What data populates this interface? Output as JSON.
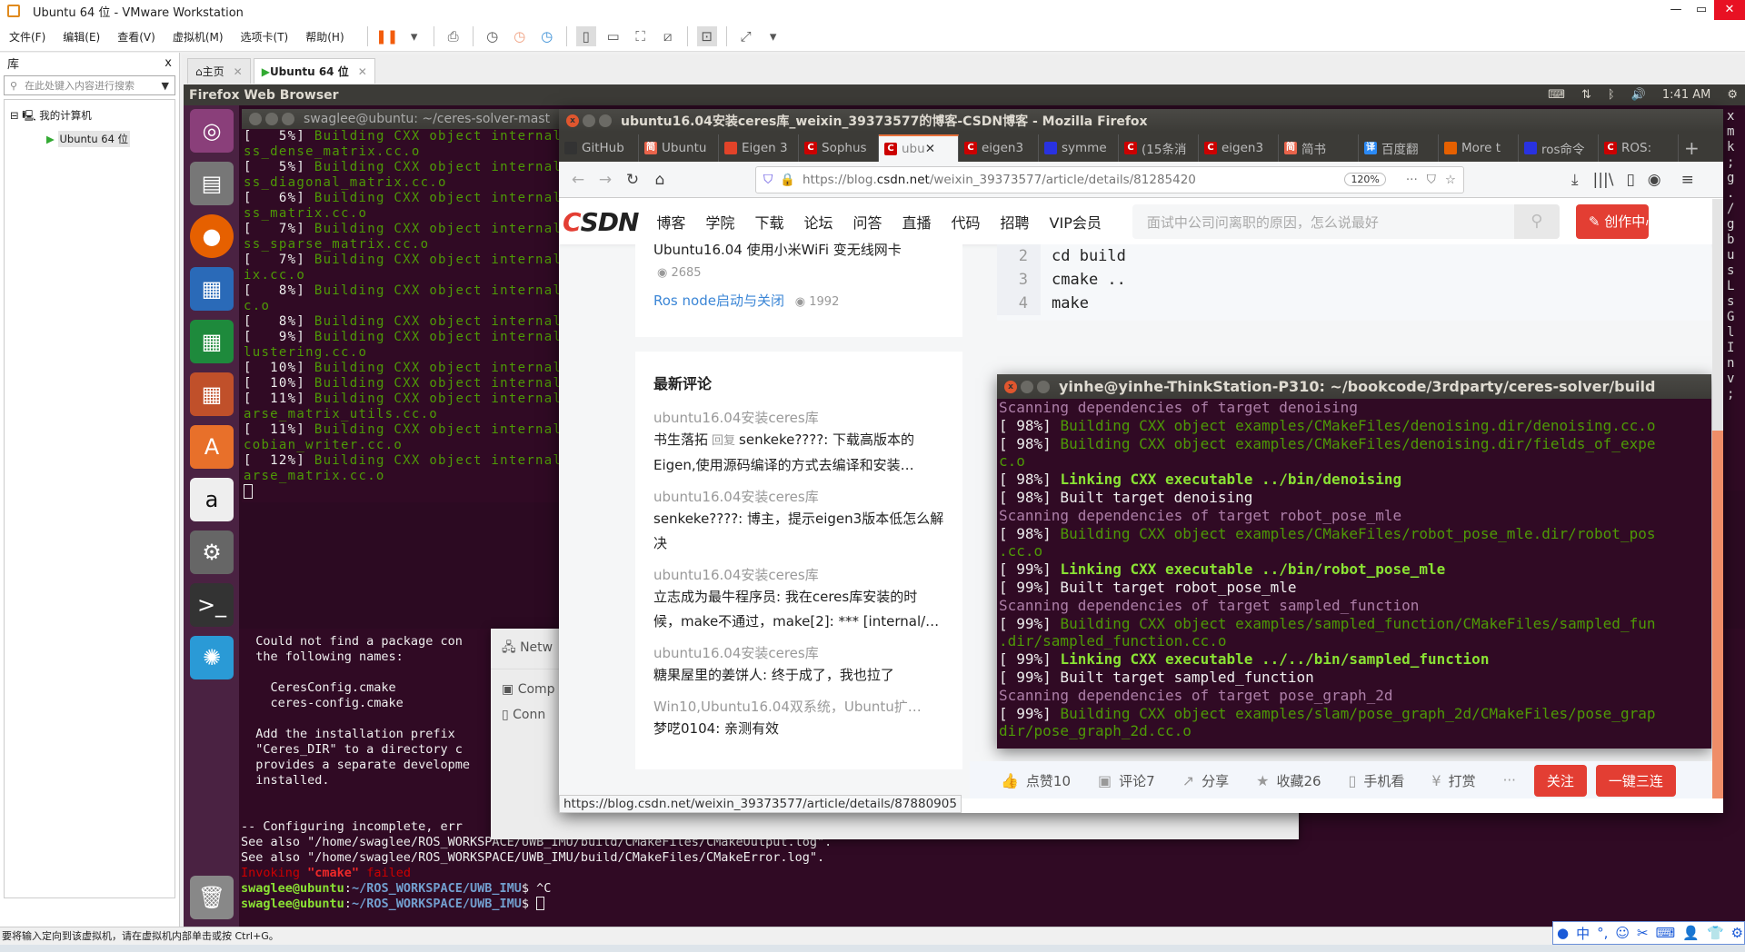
{
  "vmware": {
    "title": "Ubuntu 64 位 - VMware Workstation",
    "menu": [
      "文件(F)",
      "编辑(E)",
      "查看(V)",
      "虚拟机(M)",
      "选项卡(T)",
      "帮助(H)"
    ],
    "library": {
      "title": "库",
      "close": "x",
      "search_placeholder": "在此处键入内容进行搜索",
      "tree_root": "我的计算机",
      "tree_vm": "Ubuntu 64 位"
    },
    "tabs": [
      {
        "label": "主页"
      },
      {
        "label": "Ubuntu 64 位"
      }
    ],
    "statusbar": "要将输入定向到该虚拟机，请在虚拟机内部单击或按 Ctrl+G。"
  },
  "ubuntu": {
    "panel_title": "Firefox Web Browser",
    "clock": "1:41 AM"
  },
  "left_terminal": {
    "title": "swaglee@ubuntu: ~/ceres-solver-mast",
    "lines": [
      [
        "[   5%] ",
        "Building CXX object internal/cer"
      ],
      [
        "",
        "ss_dense_matrix.cc.o"
      ],
      [
        "[   5%] ",
        "Building CXX object internal/cer"
      ],
      [
        "",
        "ss_diagonal_matrix.cc.o"
      ],
      [
        "[   6%] ",
        "Building CXX object internal/cer"
      ],
      [
        "",
        "ss_matrix.cc.o"
      ],
      [
        "[   7%] ",
        "Building CXX object internal/cer"
      ],
      [
        "",
        "ss_sparse_matrix.cc.o"
      ],
      [
        "[   7%] ",
        "Building CXX object internal/cer"
      ],
      [
        "",
        "ix.cc.o"
      ],
      [
        "[   8%] ",
        "Building CXX object internal/cer"
      ],
      [
        "",
        "c.o"
      ],
      [
        "[   8%] ",
        "Building CXX object internal/cer"
      ],
      [
        "[   9%] ",
        "Building CXX object internal/cer"
      ],
      [
        "",
        "lustering.cc.o"
      ],
      [
        "[  10%] ",
        "Building CXX object internal/cer"
      ],
      [
        "[  10%] ",
        "Building CXX object internal/cer"
      ],
      [
        "[  11%] ",
        "Building CXX object internal/cer"
      ],
      [
        "",
        "arse_matrix_utils.cc.o"
      ],
      [
        "[  11%] ",
        "Building CXX object internal/cer"
      ],
      [
        "",
        "cobian_writer.cc.o"
      ],
      [
        "[  12%] ",
        "Building CXX object internal/cer"
      ],
      [
        "",
        "arse_matrix.cc.o"
      ]
    ]
  },
  "bottom_terminal": {
    "lines": [
      "  Could not find a package con",
      "  the following names:",
      "",
      "    CeresConfig.cmake",
      "    ceres-config.cmake",
      "",
      "  Add the installation prefix",
      "  \"Ceres_DIR\" to a directory c",
      "  provides a separate developme",
      "  installed.",
      "",
      "",
      "-- Configuring incomplete, err",
      "See also \"/home/swaglee/ROS_WORKSPACE/UWB_IMU/build/CMakeFiles/CMakeOutput.log\".",
      "See also \"/home/swaglee/ROS_WORKSPACE/UWB_IMU/build/CMakeFiles/CMakeError.log\"."
    ],
    "invoking": "Invoking ",
    "cmake": "\"cmake\"",
    "failed": " failed",
    "prompt_user": "swaglee@ubuntu",
    "prompt_path": "~/ROS_WORKSPACE/UWB_IMU",
    "cmd1": " ^C",
    "cmd2": " "
  },
  "settings_panel": {
    "items": [
      "Netw",
      "Comp",
      "Conn"
    ]
  },
  "right_strip": [
    "x",
    "m",
    "k",
    ";",
    "g",
    ".",
    "/",
    "g",
    "b",
    "u",
    "s",
    "L",
    "s",
    "G",
    "l",
    "I",
    "n",
    "v",
    ";"
  ],
  "firefox": {
    "title": "ubuntu16.04安装ceres库_weixin_39373577的博客-CSDN博客 - Mozilla Firefox",
    "tabs": [
      {
        "label": "GitHub",
        "fav": "github",
        "color": "#333"
      },
      {
        "label": "Ubuntu",
        "fav": "简",
        "color": "#e9644b"
      },
      {
        "label": "Eigen 3",
        "fav": "gitlab",
        "color": "#e24329"
      },
      {
        "label": "Sophus",
        "fav": "C",
        "color": "#c00"
      },
      {
        "label": "ubu",
        "fav": "C",
        "color": "#c00",
        "active": true
      },
      {
        "label": "eigen3",
        "fav": "C",
        "color": "#c00"
      },
      {
        "label": "symme",
        "fav": "baidu",
        "color": "#2932e1"
      },
      {
        "label": "(15条消",
        "fav": "C",
        "color": "#c00"
      },
      {
        "label": "eigen3",
        "fav": "C",
        "color": "#c00"
      },
      {
        "label": "简书",
        "fav": "简",
        "color": "#e9644b"
      },
      {
        "label": "百度翻",
        "fav": "译",
        "color": "#2b8af6"
      },
      {
        "label": "More t",
        "fav": "firefox",
        "color": "#e66000"
      },
      {
        "label": "ros命令",
        "fav": "baidu",
        "color": "#2932e1"
      },
      {
        "label": "ROS:",
        "fav": "C",
        "color": "#c00"
      }
    ],
    "url_proto": "https://blog.",
    "url_host": "csdn.net",
    "url_path": "/weixin_39373577/article/details/81285420",
    "zoom": "120%",
    "status_url": "https://blog.csdn.net/weixin_39373577/article/details/87880905"
  },
  "csdn": {
    "nav": [
      "博客",
      "学院",
      "下载",
      "论坛",
      "问答",
      "直播",
      "代码",
      "招聘",
      "VIP会员"
    ],
    "search_placeholder": "面试中公司问离职的原因，怎么说最好",
    "create": "创作中心",
    "articles": [
      {
        "title": "Ubuntu16.04 使用小米WiFi 变无线网卡",
        "views": "2685"
      },
      {
        "title": "Ros node启动与关闭",
        "views": "1992"
      }
    ],
    "comments_title": "最新评论",
    "comments": [
      {
        "article": "ubuntu16.04安装ceres库",
        "user": "书生落拓",
        "reply": "回复",
        "body": "senkeke????: 下载高版本的Eigen,使用源码编译的方式去编译和安装…"
      },
      {
        "article": "ubuntu16.04安装ceres库",
        "user": "senkeke????",
        "body": ": 博主，提示eigen3版本低怎么解决"
      },
      {
        "article": "ubuntu16.04安装ceres库",
        "user": "立志成为最牛程序员",
        "body": ": 我在ceres库安装的时候，make不通过，make[2]: *** [internal/…"
      },
      {
        "article": "ubuntu16.04安装ceres库",
        "user": "糖果屋里的姜饼人",
        "body": ": 终于成了，我也拉了"
      },
      {
        "article": "Win10,Ubuntu16.04双系统，Ubuntu扩…",
        "user": "梦呓0104",
        "body": ": 亲测有效"
      }
    ],
    "code": [
      {
        "n": "2",
        "t": "cd build"
      },
      {
        "n": "3",
        "t": "cmake .."
      },
      {
        "n": "4",
        "t": "make"
      }
    ],
    "toolbar": {
      "like": "点赞10",
      "comment": "评论7",
      "share": "分享",
      "fav": "收藏26",
      "mobile": "手机看",
      "reward": "打赏",
      "more": "···",
      "follow": "关注",
      "onekey": "一键三连"
    },
    "read_progress": 0.64
  },
  "right_terminal": {
    "title": "yinhe@yinhe-ThinkStation-P310: ~/bookcode/3rdparty/ceres-solver/build",
    "lines": [
      [
        "p",
        "Scanning dependencies of target denoising"
      ],
      [
        "w|g",
        "[ 98%] |Building CXX object examples/CMakeFiles/denoising.dir/denoising.cc.o"
      ],
      [
        "w|g",
        "[ 98%] |Building CXX object examples/CMakeFiles/denoising.dir/fields_of_expe"
      ],
      [
        "g",
        "c.o"
      ],
      [
        "w|gb",
        "[ 98%] |Linking CXX executable ../bin/denoising"
      ],
      [
        "w",
        "[ 98%] Built target denoising"
      ],
      [
        "p",
        "Scanning dependencies of target robot_pose_mle"
      ],
      [
        "w|g",
        "[ 98%] |Building CXX object examples/CMakeFiles/robot_pose_mle.dir/robot_pos"
      ],
      [
        "g",
        ".cc.o"
      ],
      [
        "w|gb",
        "[ 99%] |Linking CXX executable ../bin/robot_pose_mle"
      ],
      [
        "w",
        "[ 99%] Built target robot_pose_mle"
      ],
      [
        "p",
        "Scanning dependencies of target sampled_function"
      ],
      [
        "w|g",
        "[ 99%] |Building CXX object examples/sampled_function/CMakeFiles/sampled_fun"
      ],
      [
        "g",
        ".dir/sampled_function.cc.o"
      ],
      [
        "w|gb",
        "[ 99%] |Linking CXX executable ../../bin/sampled_function"
      ],
      [
        "w",
        "[ 99%] Built target sampled_function"
      ],
      [
        "p",
        "Scanning dependencies of target pose_graph_2d"
      ],
      [
        "w|g",
        "[ 99%] |Building CXX object examples/slam/pose_graph_2d/CMakeFiles/pose_grap"
      ],
      [
        "g",
        "dir/pose_graph_2d.cc.o"
      ]
    ]
  },
  "ime": {
    "label": "中"
  }
}
